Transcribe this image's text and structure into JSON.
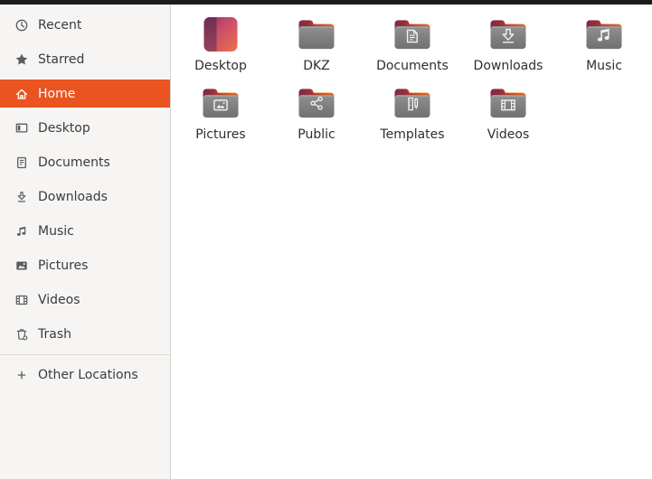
{
  "window": {
    "app": "Files",
    "topbar_color": "#1c1c1c"
  },
  "colors": {
    "accent": "#E95420",
    "sidebar_bg": "#f6f5f4",
    "sidebar_text": "#3b3b3b",
    "selected_text": "#ffffff",
    "folder_gray": "#808080",
    "folder_tab_maroon": "#7d2a47",
    "folder_tab_orange": "#f06818",
    "emblem_white": "#f3f3f3"
  },
  "sidebar": {
    "items": [
      {
        "label": "Recent",
        "icon": "recent-icon",
        "selected": false
      },
      {
        "label": "Starred",
        "icon": "starred-icon",
        "selected": false
      },
      {
        "label": "Home",
        "icon": "home-icon",
        "selected": true
      },
      {
        "label": "Desktop",
        "icon": "desktop-icon",
        "selected": false
      },
      {
        "label": "Documents",
        "icon": "documents-icon",
        "selected": false
      },
      {
        "label": "Downloads",
        "icon": "downloads-icon",
        "selected": false
      },
      {
        "label": "Music",
        "icon": "music-icon",
        "selected": false
      },
      {
        "label": "Pictures",
        "icon": "pictures-icon",
        "selected": false
      },
      {
        "label": "Videos",
        "icon": "videos-icon",
        "selected": false
      },
      {
        "label": "Trash",
        "icon": "trash-icon",
        "selected": false
      }
    ],
    "footer_items": [
      {
        "label": "Other Locations",
        "icon": "plus-icon"
      }
    ]
  },
  "files": {
    "view": "icon-grid",
    "items": [
      {
        "label": "Desktop",
        "icon": "desktop-special-icon",
        "emblem": ""
      },
      {
        "label": "DKZ",
        "icon": "folder-icon",
        "emblem": ""
      },
      {
        "label": "Documents",
        "icon": "folder-icon",
        "emblem": "document-emblem"
      },
      {
        "label": "Downloads",
        "icon": "folder-icon",
        "emblem": "download-emblem"
      },
      {
        "label": "Music",
        "icon": "folder-icon",
        "emblem": "music-emblem"
      },
      {
        "label": "Pictures",
        "icon": "folder-icon",
        "emblem": "picture-emblem"
      },
      {
        "label": "Public",
        "icon": "folder-icon",
        "emblem": "share-emblem"
      },
      {
        "label": "Templates",
        "icon": "folder-icon",
        "emblem": "template-emblem"
      },
      {
        "label": "Videos",
        "icon": "folder-icon",
        "emblem": "video-emblem"
      }
    ]
  }
}
